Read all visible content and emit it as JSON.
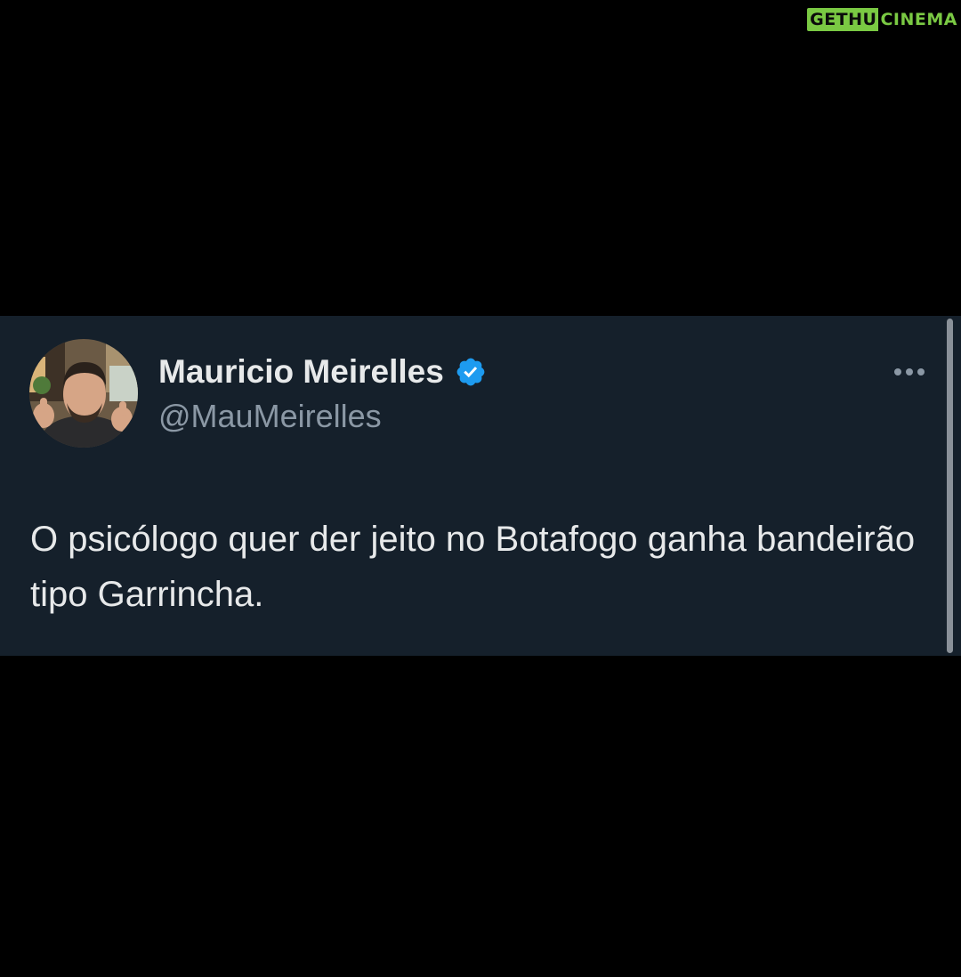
{
  "watermark": {
    "part1": "GETHU",
    "part2": "CINEMA",
    "color": "#7ac943"
  },
  "tweet": {
    "display_name": "Mauricio Meirelles",
    "handle": "@MauMeirelles",
    "verified": true,
    "verified_icon": "verified-badge-icon",
    "more_icon": "more-options-icon",
    "text": "O psicólogo quer der jeito no Botafogo ganha bandeirão tipo Garrincha.",
    "colors": {
      "card_background": "#15202b",
      "name": "#e7e9ea",
      "handle": "#8b98a5",
      "verified": "#1d9bf0"
    }
  }
}
